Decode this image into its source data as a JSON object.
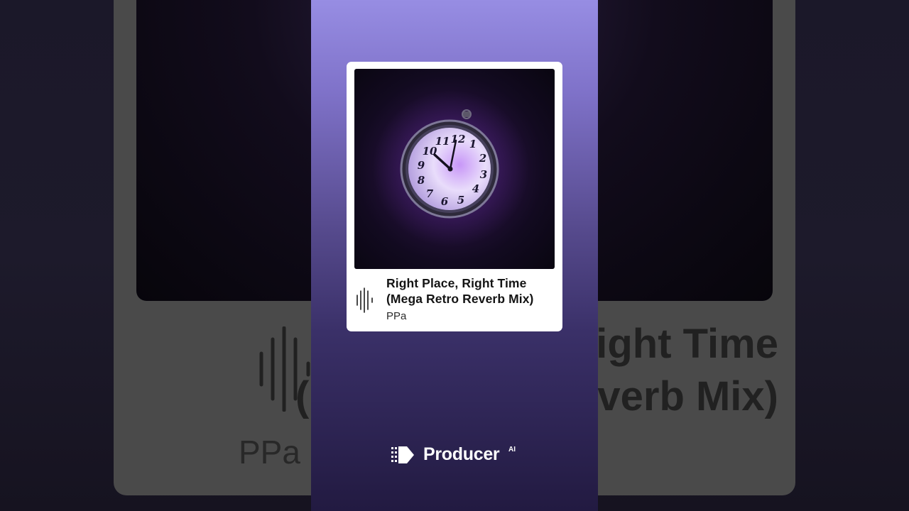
{
  "track": {
    "title": "Right Place, Right Time (Mega Retro Reverb Mix)",
    "artist": "PPa"
  },
  "background": {
    "title": "Right Place, Right Time (Mega Retro Reverb Mix)",
    "artist": "PPa"
  },
  "brand": {
    "name": "Producer",
    "suffix": "AI"
  },
  "artwork": {
    "clock_numerals": [
      "12",
      "1",
      "2",
      "3",
      "4",
      "5",
      "6",
      "7",
      "8",
      "9",
      "10",
      "11"
    ]
  },
  "icons": {
    "waveform": "waveform-icon",
    "logo": "producer-logo-icon"
  },
  "colors": {
    "panel_top": "#978de3",
    "panel_bottom": "#221a41",
    "card": "#ffffff",
    "clock_glow": "#b78cf5"
  }
}
